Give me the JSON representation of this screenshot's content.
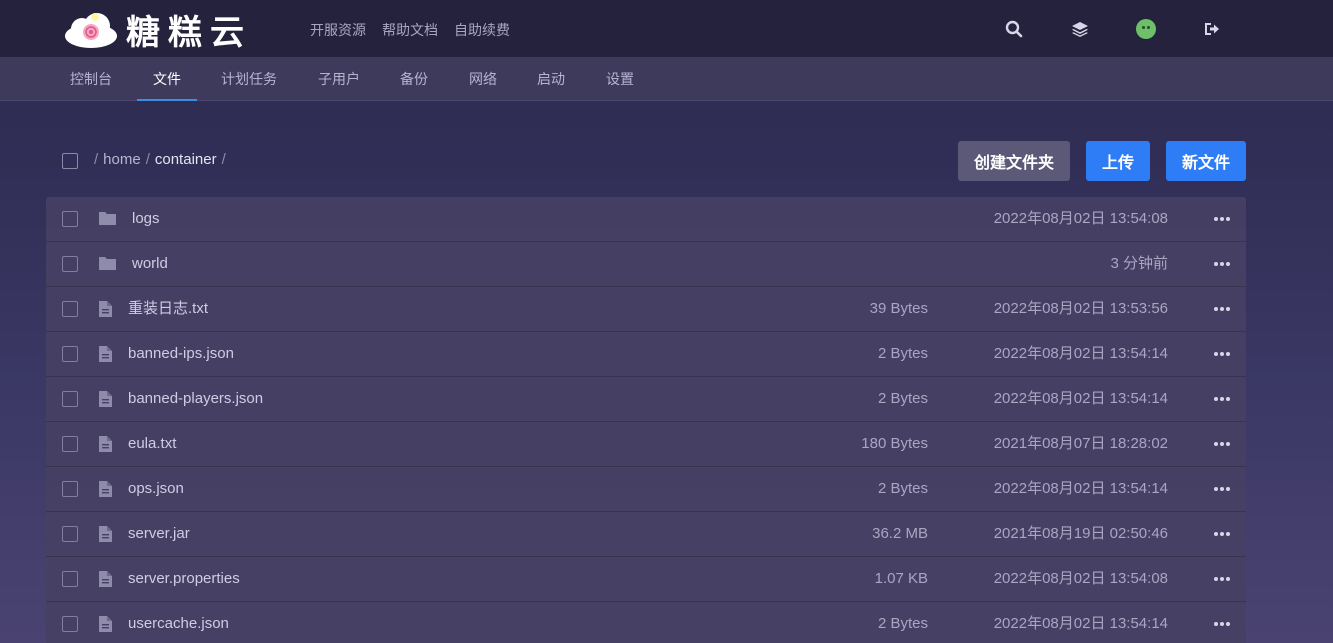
{
  "header": {
    "brand": "糖糕云",
    "links": [
      "开服资源",
      "帮助文档",
      "自助续费"
    ]
  },
  "nav": {
    "items": [
      "控制台",
      "文件",
      "计划任务",
      "子用户",
      "备份",
      "网络",
      "启动",
      "设置"
    ],
    "active": "文件"
  },
  "breadcrumb": [
    "home",
    "container"
  ],
  "toolbar": {
    "create_folder": "创建文件夹",
    "upload": "上传",
    "new_file": "新文件"
  },
  "files": [
    {
      "name": "logs",
      "type": "folder",
      "size": "",
      "modified": "2022年08月02日 13:54:08"
    },
    {
      "name": "world",
      "type": "folder",
      "size": "",
      "modified": "3 分钟前"
    },
    {
      "name": "重装日志.txt",
      "type": "file",
      "size": "39 Bytes",
      "modified": "2022年08月02日 13:53:56"
    },
    {
      "name": "banned-ips.json",
      "type": "file",
      "size": "2 Bytes",
      "modified": "2022年08月02日 13:54:14"
    },
    {
      "name": "banned-players.json",
      "type": "file",
      "size": "2 Bytes",
      "modified": "2022年08月02日 13:54:14"
    },
    {
      "name": "eula.txt",
      "type": "file",
      "size": "180 Bytes",
      "modified": "2021年08月07日 18:28:02"
    },
    {
      "name": "ops.json",
      "type": "file",
      "size": "2 Bytes",
      "modified": "2022年08月02日 13:54:14"
    },
    {
      "name": "server.jar",
      "type": "file",
      "size": "36.2 MB",
      "modified": "2021年08月19日 02:50:46"
    },
    {
      "name": "server.properties",
      "type": "file",
      "size": "1.07 KB",
      "modified": "2022年08月02日 13:54:08"
    },
    {
      "name": "usercache.json",
      "type": "file",
      "size": "2 Bytes",
      "modified": "2022年08月02日 13:54:14"
    }
  ],
  "colors": {
    "accent": "#2f7df6",
    "header_bg": "#24223d",
    "nav_bg": "#3e3a5c",
    "row_bg": "#464064"
  }
}
